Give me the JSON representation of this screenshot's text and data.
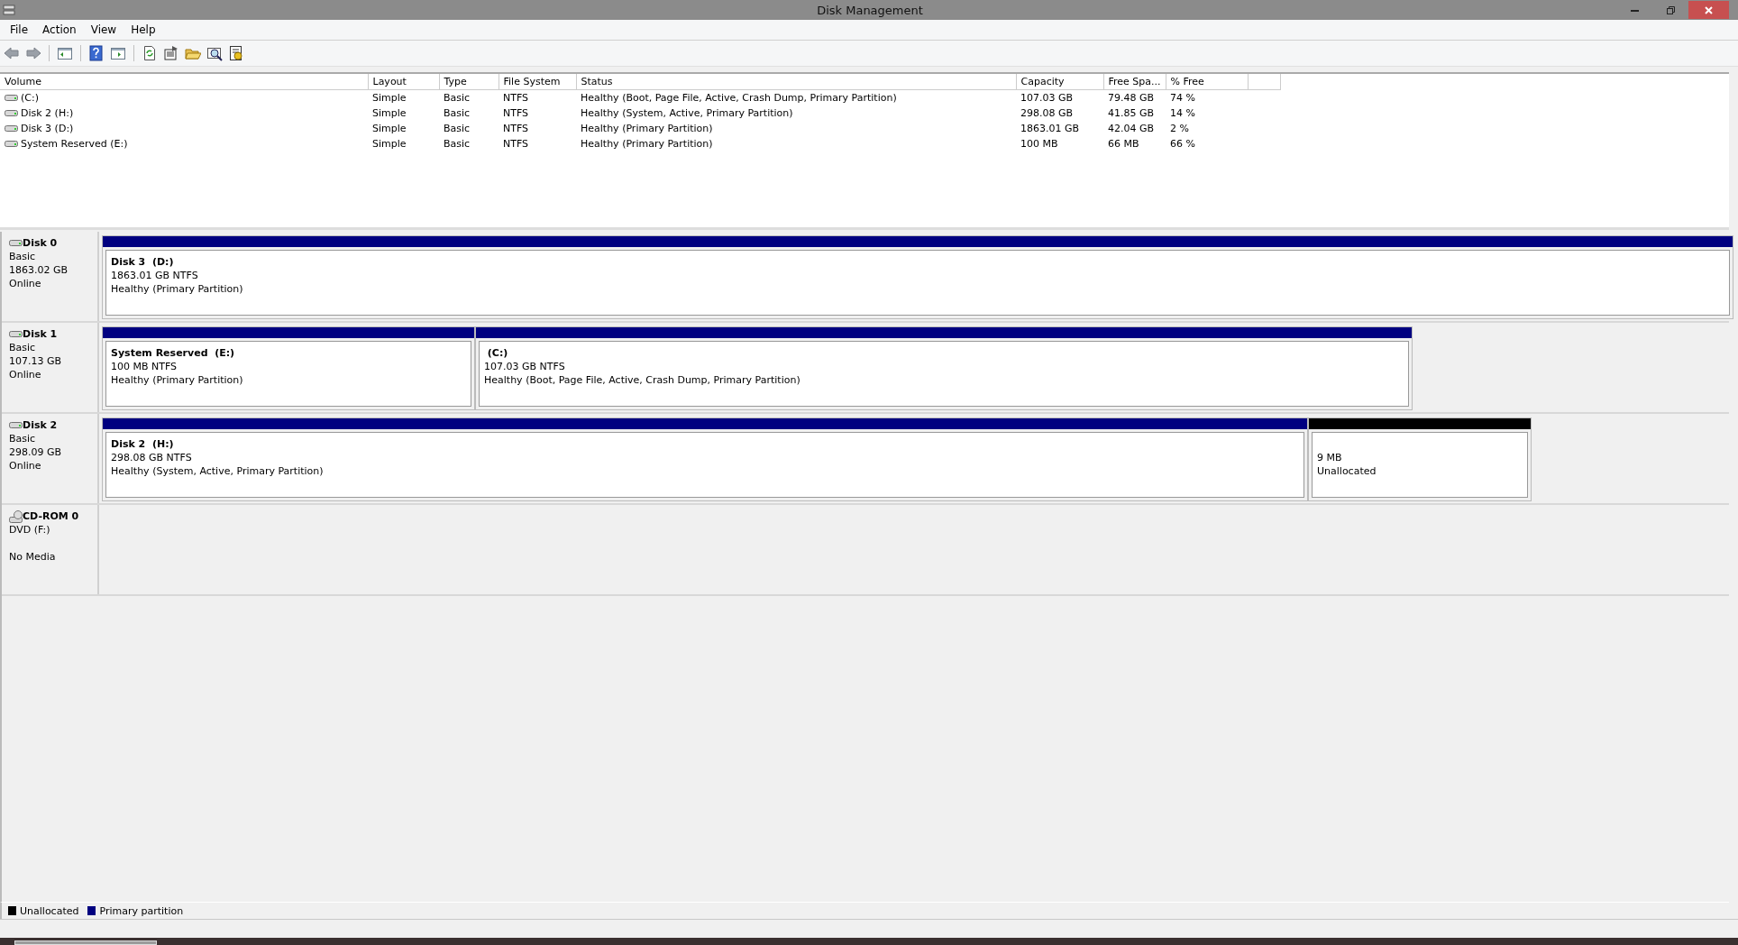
{
  "window": {
    "title": "Disk Management"
  },
  "menu": [
    "File",
    "Action",
    "View",
    "Help"
  ],
  "volumes": {
    "columns": [
      "Volume",
      "Layout",
      "Type",
      "File System",
      "Status",
      "Capacity",
      "Free Spa...",
      "% Free"
    ],
    "rows": [
      {
        "cells": [
          "(C:)",
          "Simple",
          "Basic",
          "NTFS",
          "Healthy (Boot, Page File, Active, Crash Dump, Primary Partition)",
          "107.03 GB",
          "79.48 GB",
          "74 %"
        ]
      },
      {
        "cells": [
          "Disk 2 (H:)",
          "Simple",
          "Basic",
          "NTFS",
          "Healthy (System, Active, Primary Partition)",
          "298.08 GB",
          "41.85 GB",
          "14 %"
        ]
      },
      {
        "cells": [
          "Disk 3 (D:)",
          "Simple",
          "Basic",
          "NTFS",
          "Healthy (Primary Partition)",
          "1863.01 GB",
          "42.04 GB",
          "2 %"
        ]
      },
      {
        "cells": [
          "System Reserved (E:)",
          "Simple",
          "Basic",
          "NTFS",
          "Healthy (Primary Partition)",
          "100 MB",
          "66 MB",
          "66 %"
        ]
      }
    ]
  },
  "disks": [
    {
      "kind": "disk",
      "name": "Disk 0",
      "type": "Basic",
      "size": "1863.02 GB",
      "status": "Online",
      "partitions": [
        {
          "kind": "primary",
          "title": "Disk 3  (D:)",
          "size": "1863.01 GB NTFS",
          "status": "Healthy (Primary Partition)"
        }
      ]
    },
    {
      "kind": "disk",
      "name": "Disk 1",
      "type": "Basic",
      "size": "107.13 GB",
      "status": "Online",
      "partitions": [
        {
          "kind": "primary",
          "title": "System Reserved  (E:)",
          "size": "100 MB NTFS",
          "status": "Healthy (Primary Partition)"
        },
        {
          "kind": "primary",
          "title": " (C:)",
          "size": "107.03 GB NTFS",
          "status": "Healthy (Boot, Page File, Active, Crash Dump, Primary Partition)"
        }
      ]
    },
    {
      "kind": "disk",
      "name": "Disk 2",
      "type": "Basic",
      "size": "298.09 GB",
      "status": "Online",
      "partitions": [
        {
          "kind": "primary",
          "title": "Disk 2  (H:)",
          "size": "298.08 GB NTFS",
          "status": "Healthy (System, Active, Primary Partition)"
        },
        {
          "kind": "unallocated",
          "size": "9 MB",
          "status": "Unallocated"
        }
      ]
    },
    {
      "kind": "cdrom",
      "name": "CD-ROM 0",
      "type": "DVD (F:)",
      "status": "No Media"
    }
  ],
  "legend": [
    {
      "label": "Unallocated",
      "color": "#000000"
    },
    {
      "label": "Primary partition",
      "color": "#000080"
    }
  ]
}
